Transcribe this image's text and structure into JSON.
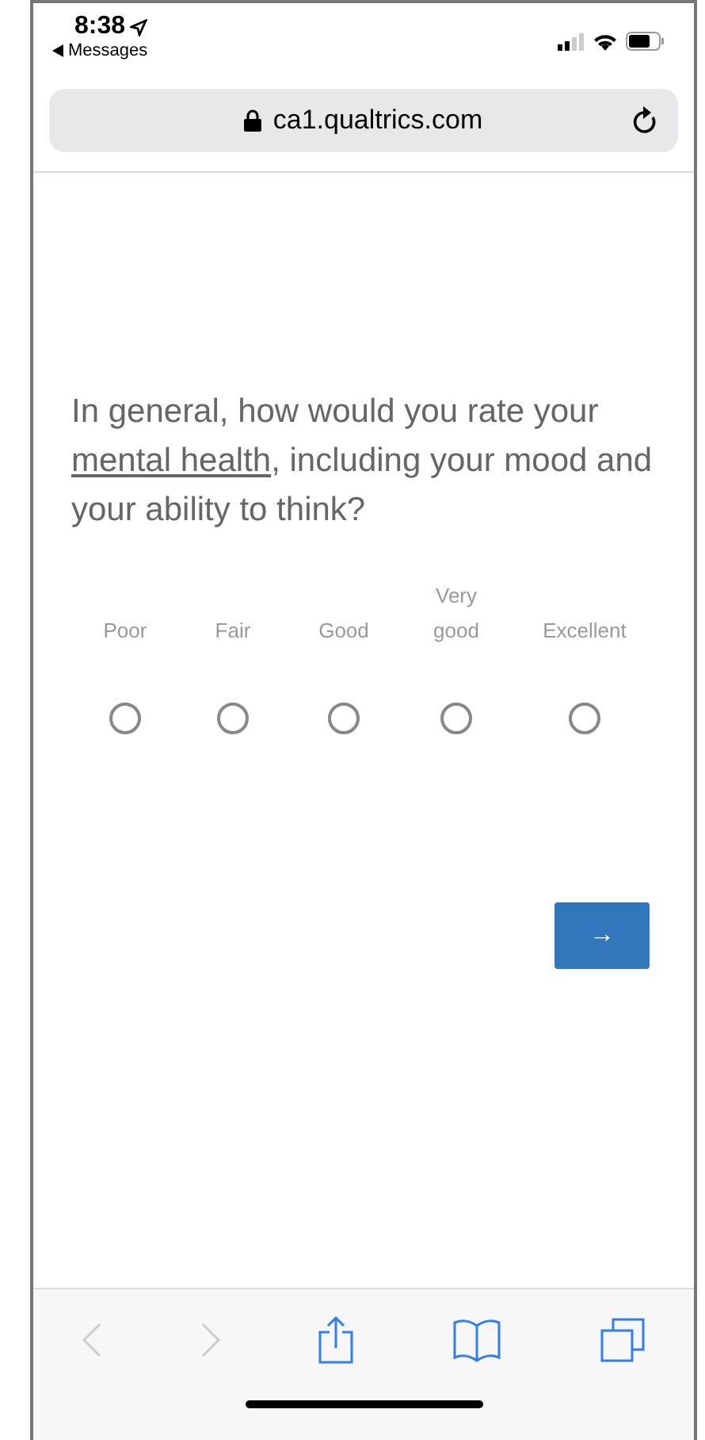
{
  "status_bar": {
    "time": "8:38",
    "back_app": "Messages"
  },
  "address_bar": {
    "url": "ca1.qualtrics.com"
  },
  "question": {
    "before": "In general, how would you rate your",
    "link": "mental health",
    "after": ", including your mood and your ability to think?"
  },
  "options": [
    {
      "label": "Poor",
      "selected": false
    },
    {
      "label": "Fair",
      "selected": false
    },
    {
      "label": "Good",
      "selected": false
    },
    {
      "label": "Very good",
      "selected": false
    },
    {
      "label": "Excellent",
      "selected": false
    }
  ],
  "next_button": {
    "label": "→"
  },
  "toolbar": {
    "back_disabled": true,
    "forward_disabled": true
  }
}
